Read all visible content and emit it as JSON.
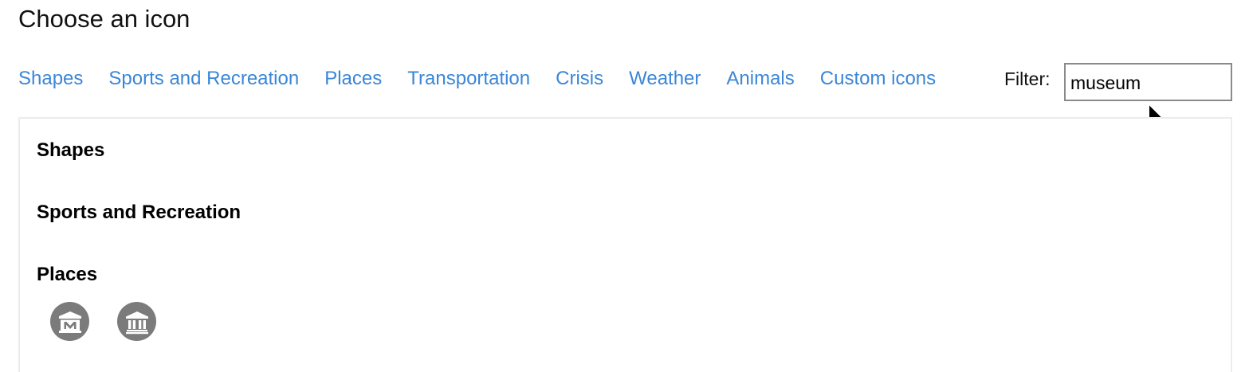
{
  "dialog": {
    "title": "Choose an icon"
  },
  "nav": {
    "categories": [
      "Shapes",
      "Sports and Recreation",
      "Places",
      "Transportation",
      "Crisis",
      "Weather",
      "Animals",
      "Custom icons"
    ]
  },
  "filter": {
    "label": "Filter:",
    "value": "museum"
  },
  "sections": [
    {
      "title": "Shapes",
      "icons": []
    },
    {
      "title": "Sports and Recreation",
      "icons": []
    },
    {
      "title": "Places",
      "icons": [
        "museum-m-icon",
        "museum-columns-icon"
      ]
    }
  ],
  "colors": {
    "link": "#3b86d6",
    "icon_background": "#7b7b7b",
    "icon_foreground": "#ffffff",
    "panel_border": "#ececec"
  }
}
